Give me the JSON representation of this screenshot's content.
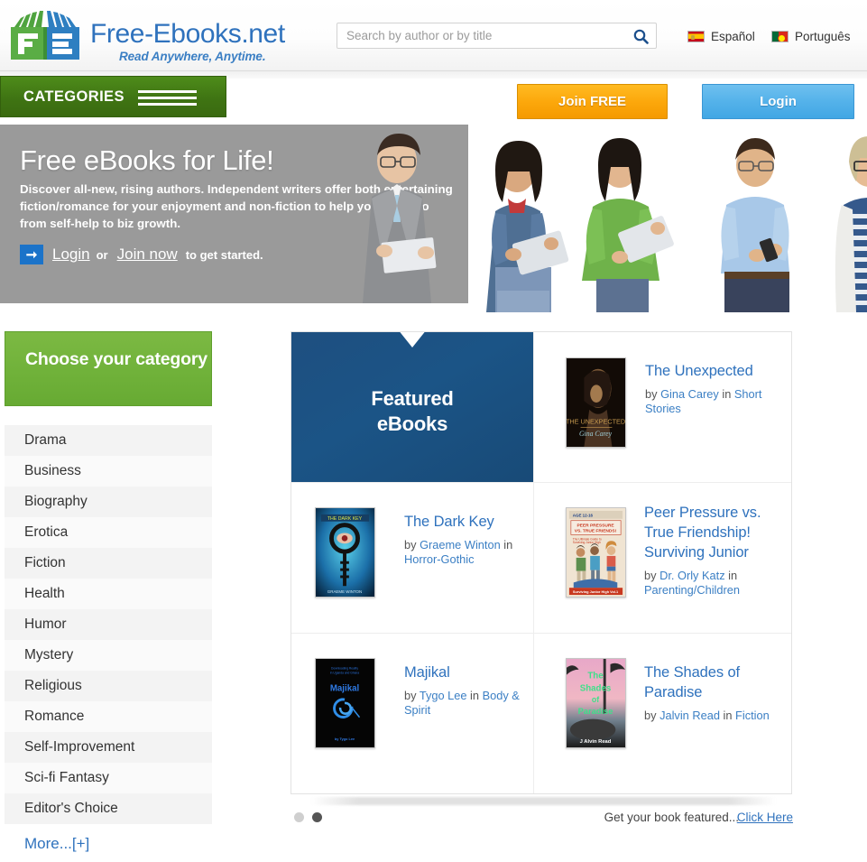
{
  "header": {
    "brand_name": "Free-Ebooks.net",
    "brand_tagline": "Read Anywhere, Anytime.",
    "search_placeholder": "Search by author or by title",
    "search_value": "",
    "languages": [
      {
        "label": "Español",
        "flag": "spain-flag-icon"
      },
      {
        "label": "Português",
        "flag": "portugal-flag-icon"
      }
    ]
  },
  "nav": {
    "categories_label": "CATEGORIES",
    "join_label": "Join FREE",
    "login_label": "Login"
  },
  "hero": {
    "title": "Free eBooks for Life!",
    "subtitle": "Discover all-new, rising authors. Independent writers offer both entertaining fiction/romance for your enjoyment and non-fiction to help you find info from self-help to biz growth.",
    "cta_login": "Login",
    "cta_or": "or",
    "cta_join": "Join now",
    "cta_suffix": "to get started."
  },
  "sidebar": {
    "heading": "Choose your category",
    "items": [
      {
        "label": "Drama"
      },
      {
        "label": "Business"
      },
      {
        "label": "Biography"
      },
      {
        "label": "Erotica"
      },
      {
        "label": "Fiction"
      },
      {
        "label": "Health"
      },
      {
        "label": "Humor"
      },
      {
        "label": "Mystery"
      },
      {
        "label": "Religious"
      },
      {
        "label": "Romance"
      },
      {
        "label": "Self-Improvement"
      },
      {
        "label": "Sci-fi Fantasy"
      },
      {
        "label": "Editor's Choice"
      }
    ],
    "more_label": "More...[+]"
  },
  "featured": {
    "promo_line1": "Featured",
    "promo_line2": "eBooks",
    "books": [
      {
        "title": "The Unexpected",
        "by_prefix": "by ",
        "author": "Gina Carey",
        "in_word": " in ",
        "category": "Short Stories",
        "cover_title": "THE UNEXPECTED",
        "cover_author": "Gina Carey"
      },
      {
        "title": "The Dark Key",
        "by_prefix": "by ",
        "author": "Graeme Winton",
        "in_word": " in ",
        "category": "Horror-Gothic",
        "cover_title": "THE DARK KEY",
        "cover_author": "Graeme Winton"
      },
      {
        "title": "Peer Pressure vs. True Friendship! Surviving Junior",
        "by_prefix": "by ",
        "author": "Dr. Orly Katz",
        "in_word": " in ",
        "category": "Parenting/Children",
        "cover_title": "PEER PRESSURE VS. TRUE FRIENDS!",
        "cover_age": "AGE 12-16",
        "cover_footer": "Surviving Junior High  Vol. 1"
      },
      {
        "title": "Majikal",
        "by_prefix": "by ",
        "author": "Tygo Lee",
        "in_word": " in ",
        "category": "Body & Spirit",
        "cover_title": "Majikal",
        "cover_top": "Downloading Reality in Uganda and Ghana",
        "cover_author": "by Tygo Lee"
      },
      {
        "title": "The Shades of Paradise",
        "by_prefix": "by ",
        "author": "Jalvin Read",
        "in_word": " in ",
        "category": "Fiction",
        "cover_title": "The Shades of Paradise",
        "cover_author": "J Alvin Read"
      }
    ],
    "footer_note": "Get your book featured...",
    "footer_link": "Click Here",
    "carousel_dots": 2,
    "carousel_active_index": 1
  },
  "colors": {
    "brand_blue": "#2f72bd",
    "nav_green": "#3f7413",
    "category_green": "#6fb139",
    "join_orange": "#fca80c",
    "login_blue": "#54b2ea",
    "promo_blue": "#1b5486",
    "hero_gray": "#9a9a9a"
  }
}
